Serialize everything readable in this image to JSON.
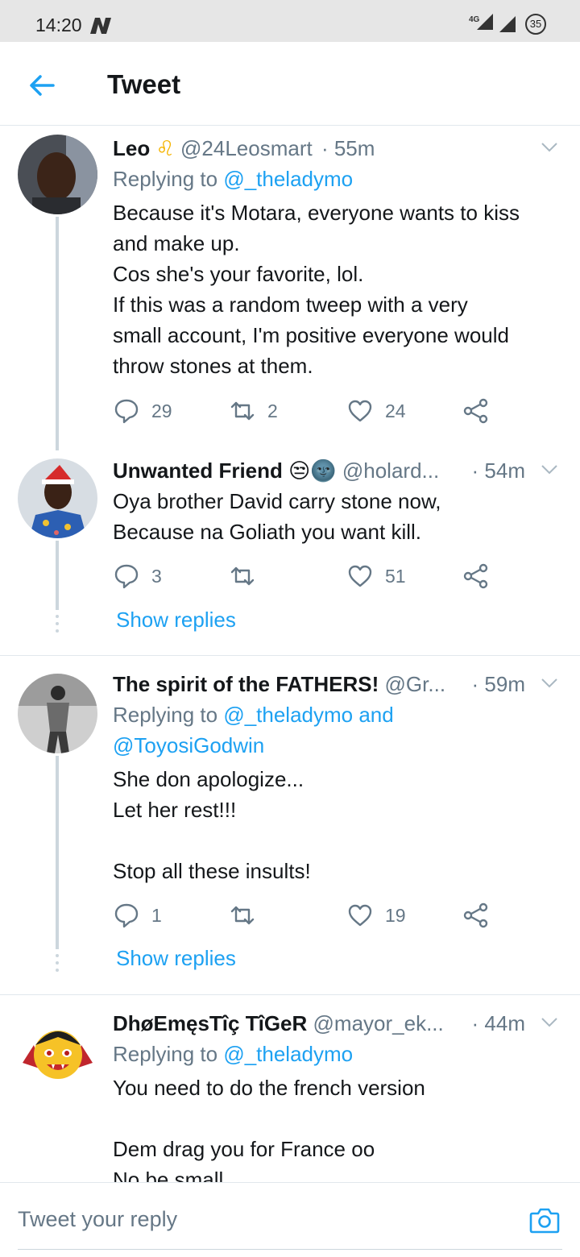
{
  "status_bar": {
    "time": "14:20",
    "network": "4G",
    "battery": "35"
  },
  "header": {
    "title": "Tweet",
    "back_icon": "arrow-left-icon"
  },
  "colors": {
    "accent": "#1da1f2",
    "muted": "#657786",
    "text": "#14171a",
    "divider": "#e1e8ed"
  },
  "tweets": [
    {
      "name": "Leo",
      "emoji": "♌",
      "handle": "@24Leosmart",
      "time": "· 55m",
      "replying_prefix": "Replying to ",
      "replying_to": "@_theladymo",
      "text": "Because it's Motara, everyone wants to kiss\nand make up.\nCos she's your favorite, lol.\nIf this was a random tweep with a very\nsmall account, I'm positive everyone would\nthrow stones at them.",
      "replies": "29",
      "retweets": "2",
      "likes": "24"
    },
    {
      "name": "Unwanted Friend",
      "emoji": "😒🌚",
      "handle": "@holard...",
      "time": "· 54m",
      "text": "Oya brother David carry stone now,\nBecause na Goliath you want kill.",
      "replies": "3",
      "retweets": "",
      "likes": "51",
      "show_replies": "Show replies"
    },
    {
      "name": "The spirit of the FATHERS!",
      "handle": "@Gr...",
      "time": "· 59m",
      "replying_prefix": "Replying to ",
      "replying_to": "@_theladymo and\n@ToyosiGodwin",
      "text": "She don apologize...\nLet her rest!!!\n\nStop all these insults!",
      "replies": "1",
      "retweets": "",
      "likes": "19",
      "show_replies": "Show replies"
    },
    {
      "name": "DhøEmęsTîç TîGeR",
      "handle": "@mayor_ek...",
      "time": "· 44m",
      "replying_prefix": "Replying to ",
      "replying_to": "@_theladymo",
      "text": "You need to do the french version\n\nDem drag you for France oo\nNo be small"
    }
  ],
  "reply_bar": {
    "placeholder": "Tweet your reply",
    "camera_icon": "camera-icon"
  }
}
